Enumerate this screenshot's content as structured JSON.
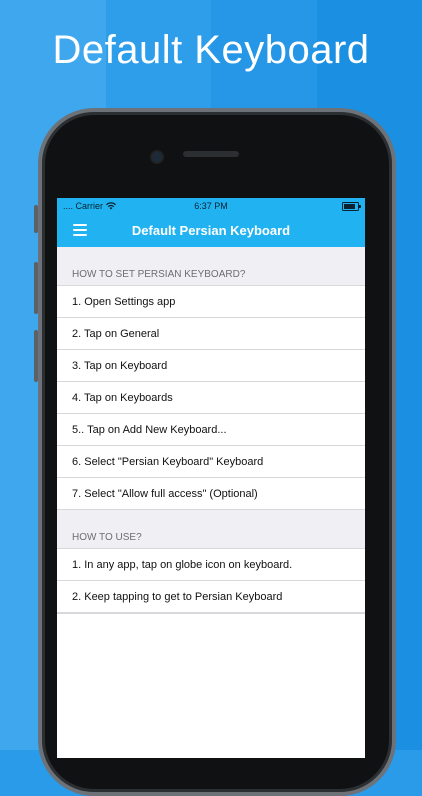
{
  "headline": "Default Keyboard",
  "status_bar": {
    "carrier": ".... Carrier",
    "time": "6:37 PM"
  },
  "nav": {
    "title": "Default Persian Keyboard",
    "menu_icon": "hamburger-icon"
  },
  "sections": [
    {
      "header": "HOW TO SET PERSIAN KEYBOARD?",
      "rows": [
        "1. Open Settings app",
        "2. Tap on General",
        "3. Tap on Keyboard",
        "4. Tap on Keyboards",
        "5.. Tap on Add New Keyboard...",
        "6. Select \"Persian Keyboard\" Keyboard",
        "7. Select \"Allow full access\" (Optional)"
      ]
    },
    {
      "header": "HOW TO USE?",
      "rows": [
        "1. In any app, tap on globe icon on keyboard.",
        "2. Keep tapping to get to Persian Keyboard"
      ]
    }
  ],
  "colors": {
    "nav_bar": "#21b3f1",
    "background": "#2a9be8"
  }
}
